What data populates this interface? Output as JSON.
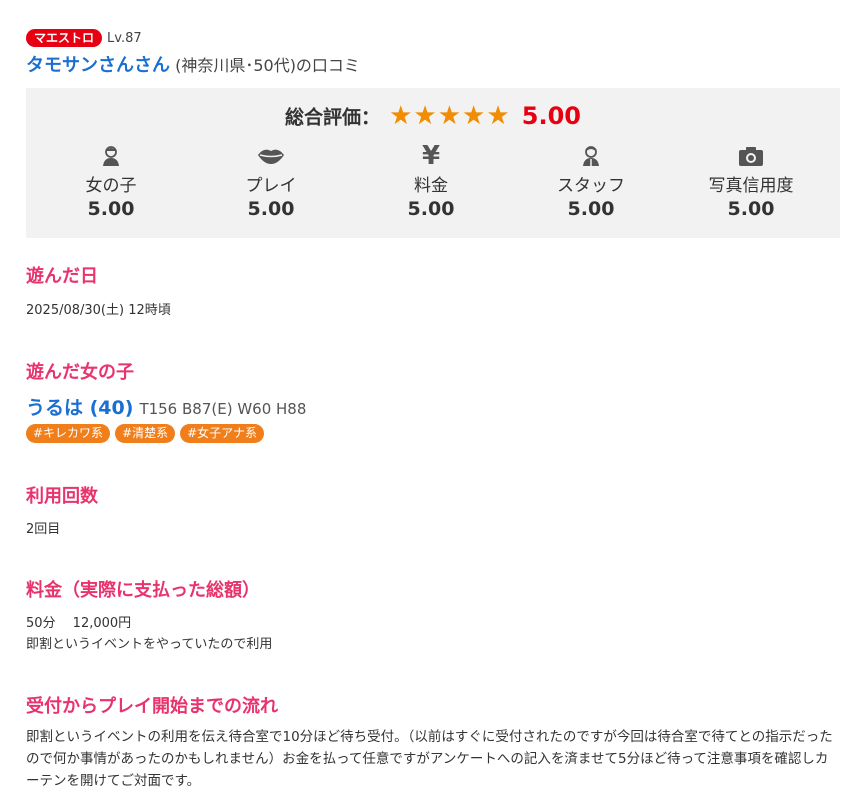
{
  "header": {
    "badge": "マエストロ",
    "level": "Lv.87",
    "author": "タモサンさんさん",
    "author_meta": " (神奈川県･50代)の口コミ"
  },
  "rating": {
    "overall_label": "総合評価：",
    "stars": 5,
    "overall_score": "5.00",
    "categories": [
      {
        "icon": "girl-icon",
        "label": "女の子",
        "score": "5.00"
      },
      {
        "icon": "lips-icon",
        "label": "プレイ",
        "score": "5.00"
      },
      {
        "icon": "yen-icon",
        "label": "料金",
        "score": "5.00"
      },
      {
        "icon": "staff-icon",
        "label": "スタッフ",
        "score": "5.00"
      },
      {
        "icon": "camera-icon",
        "label": "写真信用度",
        "score": "5.00"
      }
    ]
  },
  "sections": {
    "visit_date": {
      "heading": "遊んだ日",
      "value": "2025/08/30(土) 12時頃"
    },
    "girl": {
      "heading": "遊んだ女の子",
      "name": "うるは (40)",
      "size": "T156 B87(E) W60 H88",
      "tags": [
        "#キレカワ系",
        "#清楚系",
        "#女子アナ系"
      ]
    },
    "visits": {
      "heading": "利用回数",
      "value": "2回目"
    },
    "price": {
      "heading": "料金（実際に支払った総額）",
      "line1": "50分　 12,000円",
      "line2": "即割というイベントをやっていたので利用"
    },
    "flow": {
      "heading": "受付からプレイ開始までの流れ",
      "text": "即割というイベントの利用を伝え待合室で10分ほど待ち受付。（以前はすぐに受付されたのですが今回は待合室で待てとの指示だったので何か事情があったのかもしれません）お金を払って任意ですがアンケートへの記入を済ませて5分ほど待って注意事項を確認しカーテンを開けてご対面です。"
    }
  },
  "colors": {
    "accent_pink": "#e8336d",
    "link_blue": "#1a6fd1",
    "star_orange": "#f28c00",
    "score_red": "#e60012",
    "tag_orange": "#f07e1a"
  }
}
